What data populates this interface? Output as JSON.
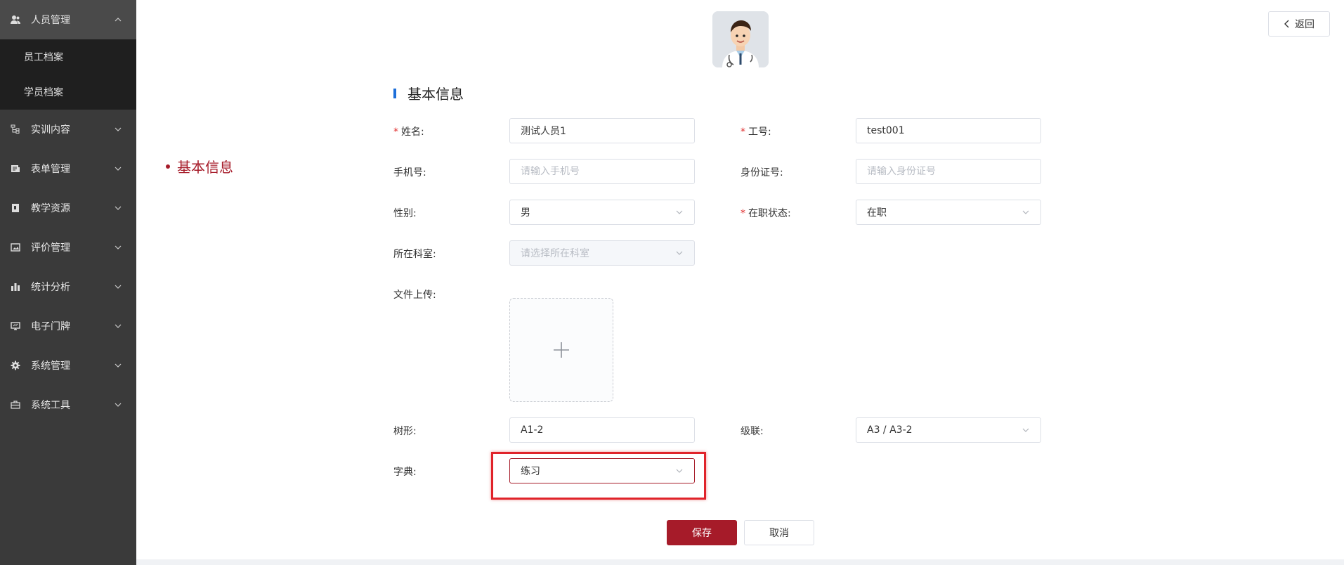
{
  "sidebar": {
    "menus": [
      {
        "label": "人员管理",
        "icon": "user-icon",
        "open": true
      },
      {
        "label": "实训内容",
        "icon": "tree-icon"
      },
      {
        "label": "表单管理",
        "icon": "form-icon"
      },
      {
        "label": "教学资源",
        "icon": "book-icon"
      },
      {
        "label": "评价管理",
        "icon": "image-icon"
      },
      {
        "label": "统计分析",
        "icon": "bar-chart-icon"
      },
      {
        "label": "电子门牌",
        "icon": "monitor-icon"
      },
      {
        "label": "系统管理",
        "icon": "gear-icon"
      },
      {
        "label": "系统工具",
        "icon": "toolbox-icon"
      }
    ],
    "submenu": [
      {
        "label": "员工档案"
      },
      {
        "label": "学员档案"
      }
    ]
  },
  "header": {
    "back_label": "返回"
  },
  "anchor": {
    "label": "基本信息"
  },
  "form": {
    "section_title": "基本信息",
    "name": {
      "label": "姓名:",
      "value": "测试人员1"
    },
    "job_no": {
      "label": "工号:",
      "value": "test001"
    },
    "phone": {
      "label": "手机号:",
      "placeholder": "请输入手机号"
    },
    "id_card": {
      "label": "身份证号:",
      "placeholder": "请输入身份证号"
    },
    "gender": {
      "label": "性别:",
      "value": "男"
    },
    "status": {
      "label": "在职状态:",
      "value": "在职"
    },
    "department": {
      "label": "所在科室:",
      "placeholder": "请选择所在科室"
    },
    "upload": {
      "label": "文件上传:"
    },
    "tree": {
      "label": "树形:",
      "value": "A1-2"
    },
    "cascade": {
      "label": "级联:",
      "value": "A3 / A3-2"
    },
    "dict": {
      "label": "字典:",
      "value": "练习"
    },
    "required_mark": "*"
  },
  "actions": {
    "save_label": "保存",
    "cancel_label": "取消"
  },
  "colors": {
    "brand": "#a61b29",
    "sidebar_bg": "#3a3a3a",
    "submenu_bg": "#1f1f1f",
    "accent_bar": "#1e6fd9",
    "required": "#e02b2b",
    "highlight": "#e0232a"
  }
}
